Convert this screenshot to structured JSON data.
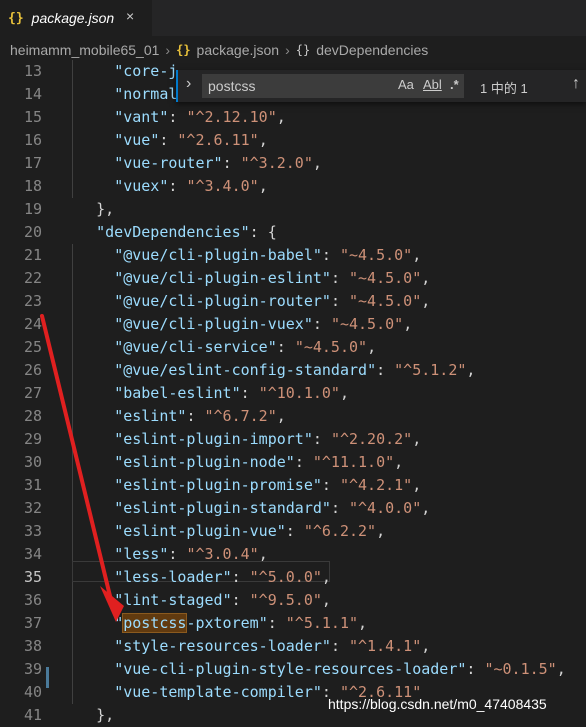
{
  "tab": {
    "icon": "json-braces-icon",
    "braces": "{}",
    "label": "package.json",
    "close": "×"
  },
  "breadcrumbs": {
    "folder": "heimamm_mobile65_01",
    "file_icon": "{}",
    "file": "package.json",
    "symbol_icon": "{}",
    "symbol": "devDependencies"
  },
  "find": {
    "chevron": "›",
    "query": "postcss",
    "match_case": "Aa",
    "whole_word": "Abl",
    "regex": ".*",
    "result": "1 中的 1",
    "prev": "↑"
  },
  "lines": [
    {
      "n": "13",
      "key": "core-j",
      "val": ""
    },
    {
      "n": "14",
      "key": "normal",
      "val": ""
    },
    {
      "n": "15",
      "key": "vant",
      "val": "^2.12.10"
    },
    {
      "n": "16",
      "key": "vue",
      "val": "^2.6.11"
    },
    {
      "n": "17",
      "key": "vue-router",
      "val": "^3.2.0"
    },
    {
      "n": "18",
      "key": "vuex",
      "val": "^3.4.0"
    },
    {
      "n": "19",
      "text": "},"
    },
    {
      "n": "20",
      "key": "devDependencies",
      "text": ": {"
    },
    {
      "n": "21",
      "key": "@vue/cli-plugin-babel",
      "val": "~4.5.0"
    },
    {
      "n": "22",
      "key": "@vue/cli-plugin-eslint",
      "val": "~4.5.0"
    },
    {
      "n": "23",
      "key": "@vue/cli-plugin-router",
      "val": "~4.5.0"
    },
    {
      "n": "24",
      "key": "@vue/cli-plugin-vuex",
      "val": "~4.5.0"
    },
    {
      "n": "25",
      "key": "@vue/cli-service",
      "val": "~4.5.0"
    },
    {
      "n": "26",
      "key": "@vue/eslint-config-standard",
      "val": "^5.1.2"
    },
    {
      "n": "27",
      "key": "babel-eslint",
      "val": "^10.1.0"
    },
    {
      "n": "28",
      "key": "eslint",
      "val": "^6.7.2"
    },
    {
      "n": "29",
      "key": "eslint-plugin-import",
      "val": "^2.20.2"
    },
    {
      "n": "30",
      "key": "eslint-plugin-node",
      "val": "^11.1.0"
    },
    {
      "n": "31",
      "key": "eslint-plugin-promise",
      "val": "^4.2.1"
    },
    {
      "n": "32",
      "key": "eslint-plugin-standard",
      "val": "^4.0.0"
    },
    {
      "n": "33",
      "key": "eslint-plugin-vue",
      "val": "^6.2.2"
    },
    {
      "n": "34",
      "key": "less",
      "val": "^3.0.4"
    },
    {
      "n": "35",
      "key": "less-loader",
      "val": "^5.0.0"
    },
    {
      "n": "36",
      "key": "lint-staged",
      "val": "^9.5.0"
    },
    {
      "n": "37",
      "key": "postcss-pxtorem",
      "val": "^5.1.1",
      "match": "postcss"
    },
    {
      "n": "38",
      "key": "style-resources-loader",
      "val": "^1.4.1"
    },
    {
      "n": "39",
      "key": "vue-cli-plugin-style-resources-loader",
      "val": "~0.1.5"
    },
    {
      "n": "40",
      "key": "vue-template-compiler",
      "val": "^2.6.11"
    },
    {
      "n": "41",
      "text": "},"
    }
  ],
  "watermark": "https://blog.csdn.net/m0_47408435",
  "colors": {
    "annotation_arrow": "#e02020",
    "match_highlight": "#613a0f"
  }
}
